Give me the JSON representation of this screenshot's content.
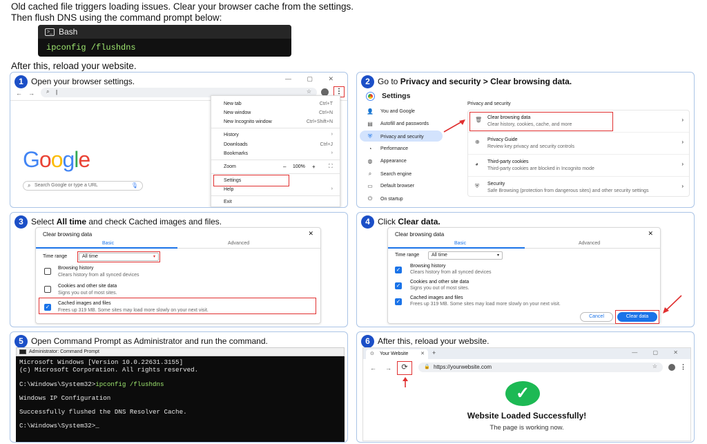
{
  "intro": {
    "line1": "Old cached file triggers loading issues. Clear your browser cache from the settings.",
    "line2": "Then flush DNS using the command prompt below:",
    "code_title": "Bash",
    "code_cmd": "ipconfig /flushdns",
    "after": "After this, reload your website."
  },
  "step1": {
    "num": "1",
    "title": "Open your browser settings.",
    "google": "Google",
    "search_placeholder": "Search Google or type a URL",
    "address": "|",
    "menu": {
      "new_tab": "New tab",
      "new_tab_sc": "Ctrl+T",
      "new_window": "New window",
      "new_window_sc": "Ctrl+N",
      "incognito": "New Incognito window",
      "incognito_sc": "Ctrl+Shift+N",
      "history": "History",
      "downloads": "Downloads",
      "downloads_sc": "Ctrl+J",
      "bookmarks": "Bookmarks",
      "zoom": "Zoom",
      "zoom_minus": "–",
      "zoom_val": "100%",
      "zoom_plus": "+",
      "settings": "Settings",
      "help": "Help",
      "exit": "Exit"
    }
  },
  "step2": {
    "num": "2",
    "title_pre": "Go to ",
    "title_bold": "Privacy and security > Clear browsing data.",
    "settings_title": "Settings",
    "nav": [
      "You and Google",
      "Autofill and passwords",
      "Privacy and security",
      "Performance",
      "Appearance",
      "Search engine",
      "Default browser",
      "On startup"
    ],
    "section": "Privacy and security",
    "rows": [
      {
        "title": "Clear browsing data",
        "desc": "Clear history, cookies, cache, and more"
      },
      {
        "title": "Privacy Guide",
        "desc": "Review key privacy and security controls"
      },
      {
        "title": "Third-party cookies",
        "desc": "Third-party cookies are blocked in Incognito mode"
      },
      {
        "title": "Security",
        "desc": "Safe Browsing (protection from dangerous sites) and other security settings"
      }
    ]
  },
  "step3": {
    "num": "3",
    "title_pre": "Select ",
    "title_b1": "All time",
    "title_post": " and check Cached images and files.",
    "dialog_title": "Clear browsing data",
    "tab_basic": "Basic",
    "tab_adv": "Advanced",
    "range_label": "Time range",
    "range_value": "All time",
    "items": [
      {
        "title": "Browsing history",
        "desc": "Clears history from all synced devices"
      },
      {
        "title": "Cookies and other site data",
        "desc": "Signs you out of most sites."
      },
      {
        "title": "Cached images and files",
        "desc": "Frees up 319 MB. Some sites may load more slowly on your next visit."
      }
    ]
  },
  "step4": {
    "num": "4",
    "title_pre": "Click ",
    "title_bold": "Clear data.",
    "dialog_title": "Clear browsing data",
    "tab_basic": "Basic",
    "tab_adv": "Advanced",
    "range_label": "Time range",
    "range_value": "All time",
    "items": [
      {
        "title": "Browsing history",
        "desc": "Clears history from all synced devices"
      },
      {
        "title": "Cookies and other site data",
        "desc": "Signs you out of most sites."
      },
      {
        "title": "Cached images and files",
        "desc": "Frees up 319 MB. Some sites may load more slowly on your next visit."
      }
    ],
    "cancel": "Cancel",
    "clear": "Clear data"
  },
  "step5": {
    "num": "5",
    "title": "Open Command Prompt as Administrator and run the command.",
    "window_title": "Administrator: Command Prompt",
    "lines": [
      "Microsoft Windows [Version 10.0.22631.3155]",
      "(c) Microsoft Corporation. All rights reserved.",
      "",
      "C:\\Windows\\System32>ipconfig /flushdns",
      "",
      "Windows IP Configuration",
      "",
      "Successfully flushed the DNS Resolver Cache.",
      "",
      "C:\\Windows\\System32>_"
    ]
  },
  "step6": {
    "num": "6",
    "title": "After this, reload your website.",
    "tab_title": "Your Website",
    "url": "https://yourwebsite.com",
    "success": "Website Loaded Successfully!",
    "sub": "The page is working now."
  },
  "colors": {
    "accent": "#1b4fc7",
    "highlight": "#e03030",
    "chrome_blue": "#1a73e8",
    "success": "#1db954"
  }
}
